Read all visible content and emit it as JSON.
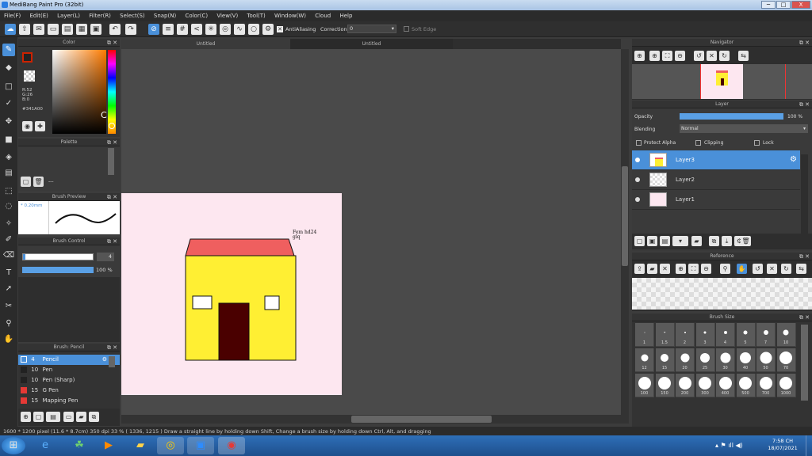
{
  "window": {
    "title": "MediBang Paint Pro (32bit)",
    "min": "─",
    "max": "□",
    "close": "X"
  },
  "menu": [
    "File(F)",
    "Edit(E)",
    "Layer(L)",
    "Filter(R)",
    "Select(S)",
    "Snap(N)",
    "Color(C)",
    "View(V)",
    "Tool(T)",
    "Window(W)",
    "Cloud",
    "Help"
  ],
  "toolbar": {
    "antialiasing": "AntiAliasing",
    "correction_label": "Correction",
    "correction_value": "0",
    "softedge": "Soft Edge"
  },
  "tabs": [
    "Untitled",
    "Untitled"
  ],
  "color_panel": {
    "title": "Color",
    "r": "R:52",
    "g": "G:26",
    "b": "B:0",
    "hex": "#341A00",
    "c_label": "C"
  },
  "palette_panel": {
    "title": "Palette",
    "name": "---"
  },
  "brush_preview": {
    "title": "Brush Preview",
    "size": "* 0.20mm"
  },
  "brush_control": {
    "title": "Brush Control",
    "size": "4",
    "opacity": "100 %"
  },
  "brush_list": {
    "title": "Brush: Pencil",
    "items": [
      {
        "size": "4",
        "name": "Pencil",
        "color": "#4a90d9"
      },
      {
        "size": "10",
        "name": "Pen",
        "color": "#222222"
      },
      {
        "size": "10",
        "name": "Pen (Sharp)",
        "color": "#222222"
      },
      {
        "size": "15",
        "name": "G Pen",
        "color": "#e53935"
      },
      {
        "size": "15",
        "name": "Mapping Pen",
        "color": "#e53935"
      }
    ]
  },
  "canvas": {
    "note": "Fem hd24\nglq"
  },
  "navigator": {
    "title": "Navigator"
  },
  "layer_panel": {
    "title": "Layer",
    "opacity_label": "Opacity",
    "opacity_value": "100 %",
    "opacity": 1.0,
    "blending_label": "Blending",
    "blending_value": "Normal",
    "protect_alpha": "Protect Alpha",
    "clipping": "Clipping",
    "lock": "Lock",
    "layers": [
      {
        "name": "Layer3",
        "selected": true
      },
      {
        "name": "Layer2",
        "selected": false
      },
      {
        "name": "Layer1",
        "selected": false
      }
    ]
  },
  "reference": {
    "title": "Reference"
  },
  "brush_size": {
    "title": "Brush Size",
    "sizes": [
      "1",
      "1.5",
      "2",
      "3",
      "4",
      "5",
      "7",
      "10",
      "12",
      "15",
      "20",
      "25",
      "30",
      "40",
      "50",
      "70",
      "100",
      "150",
      "200",
      "300",
      "400",
      "500",
      "700",
      "1000"
    ]
  },
  "status": "1600 * 1200 pixel  (11.6 * 8.7cm)  350 dpi  33 %  ( 1336, 1215 )  Draw a straight line by holding down Shift, Change a brush size by holding down Ctrl, Alt, and dragging",
  "clock": {
    "time": "7:58 CH",
    "date": "18/07/2021"
  },
  "colors": {
    "accent": "#4a90d9",
    "fg": "#cc2200",
    "house_wall": "#ffef33",
    "roof": "#ef5f5f",
    "door": "#4a0000",
    "canvas_bg": "#fde7f0"
  }
}
